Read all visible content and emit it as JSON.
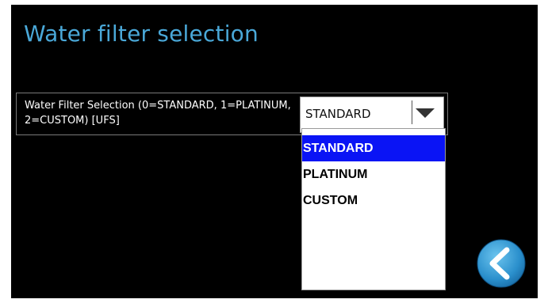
{
  "page": {
    "title": "Water filter selection"
  },
  "parameter": {
    "label": "Water Filter Selection (0=STANDARD, 1=PLATINUM, 2=CUSTOM) [UFS]",
    "selected_value": "STANDARD"
  },
  "dropdown": {
    "options": [
      {
        "label": "STANDARD",
        "selected": true
      },
      {
        "label": "PLATINUM",
        "selected": false
      },
      {
        "label": "CUSTOM",
        "selected": false
      }
    ]
  },
  "navigation": {
    "back_icon": "chevron-left-icon"
  },
  "colors": {
    "title": "#4aa8d8",
    "selection_highlight": "#0a14f5",
    "back_button": "#3aa0d8"
  }
}
